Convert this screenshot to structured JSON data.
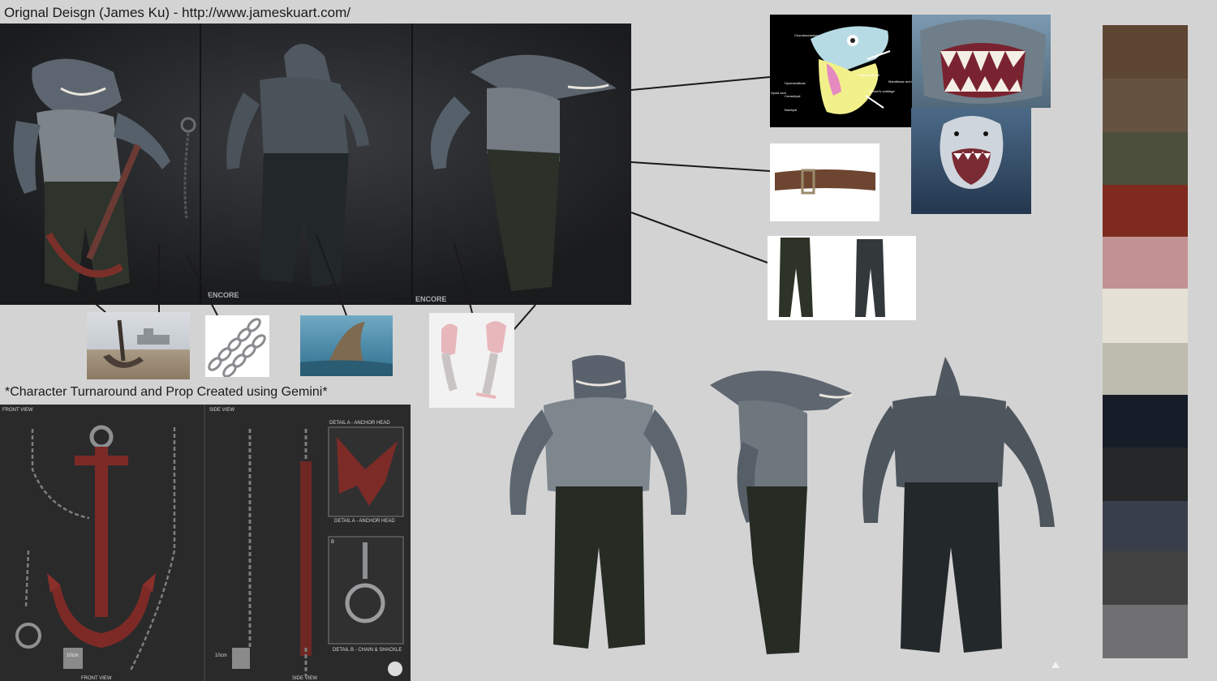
{
  "header": {
    "credit": "Orignal Deisgn (James Ku) - http://www.jameskuart.com/"
  },
  "section2": {
    "caption": "*Character Turnaround and Prop Created using Gemini*"
  },
  "concept": {
    "watermarks": [
      "ENCORE",
      "ENCORE"
    ]
  },
  "prop_sheet": {
    "front_label": "FRONT VIEW",
    "side_label": "SIDE VIEW",
    "detail_a_top": "DETAIL A - ANCHOR HEAD",
    "detail_a_bottom": "DETAIL A - ANCHOR HEAD",
    "detail_b_top": "B",
    "detail_b_bottom": "DETAIL B - CHAIN & SHACKLE",
    "scale_front": "10cm",
    "scale_side": "10cm",
    "front_footer": "FRONT VIEW",
    "side_footer": "SIDE VIEW"
  },
  "anatomy": {
    "labels": [
      "Chondrocranium",
      "Hyomandibula",
      "Ceratohyal",
      "Hyoid arch",
      "Basihyal",
      "Palatoquadrate",
      "Meckel's cartilage",
      "Mandibular arch"
    ]
  },
  "palette": {
    "swatches": [
      "#5e4634",
      "#645340",
      "#4b4f3b",
      "#7e2a1f",
      "#c29293",
      "#e5e1d7",
      "#bdbcaf",
      "#171d28",
      "#262729",
      "#393f4a",
      "#424243",
      "#707073"
    ]
  }
}
